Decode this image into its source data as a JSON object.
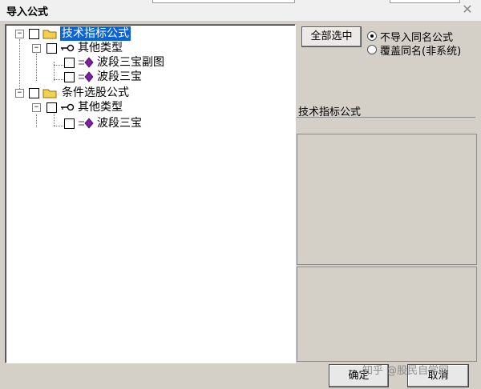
{
  "window": {
    "title": "导入公式"
  },
  "tree": {
    "nodes": [
      {
        "label": "技术指标公式",
        "selected": true
      },
      {
        "label": "其他类型"
      },
      {
        "label": "波段三宝副图"
      },
      {
        "label": "波段三宝"
      },
      {
        "label": "条件选股公式"
      },
      {
        "label": "其他类型"
      },
      {
        "label": "波段三宝"
      }
    ]
  },
  "right_panel": {
    "select_all_label": "全部选中",
    "options": [
      {
        "label": "不导入同名公式",
        "selected": true
      },
      {
        "label": "覆盖同名(非系统)",
        "selected": false
      }
    ],
    "info_title": "技术指标公式"
  },
  "footer": {
    "ok_label": "确定",
    "cancel_label": "取消",
    "watermark": "知乎 @股民自学网"
  },
  "icons": {
    "expander": "minus-box",
    "folder": "folder-icon",
    "type": "key-icon",
    "formula": "formula-diamond-icon",
    "close": "close-icon"
  }
}
